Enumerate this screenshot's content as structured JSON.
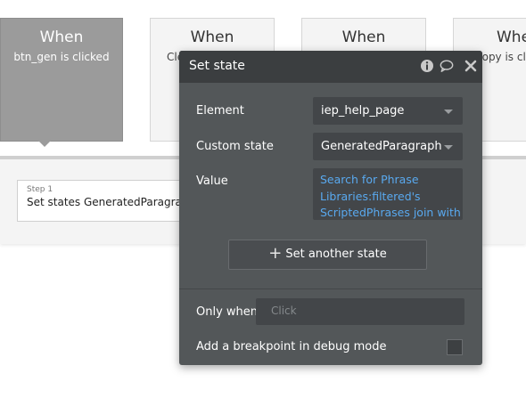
{
  "events": [
    {
      "when": "When",
      "sub": "btn_gen is clicked",
      "active": true
    },
    {
      "when": "When",
      "sub": "Cle"
    },
    {
      "when": "When",
      "sub": ""
    },
    {
      "when": "Whe",
      "sub": "copy is cl"
    }
  ],
  "step": {
    "number": "Step 1",
    "text": "Set states GeneratedParagraph"
  },
  "modal": {
    "title": "Set state",
    "icons": [
      "info-icon",
      "comment-icon",
      "close-icon"
    ],
    "element_label": "Element",
    "element_value": "iep_help_page",
    "custom_state_label": "Custom state",
    "custom_state_value": "GeneratedParagraph",
    "value_label": "Value",
    "value_lines": [
      "Search for Phrase",
      "Libraries:filtered's",
      "ScriptedPhrases join with"
    ],
    "set_another_label": "Set another state",
    "only_when_label": "Only when",
    "only_when_placeholder": "Click",
    "breakpoint_label": "Add a breakpoint in debug mode",
    "breakpoint_checked": false
  },
  "colors": {
    "modal_bg": "#535759",
    "modal_header": "#3b3e40",
    "value_text": "#59a9ef",
    "active_card": "#9b9b9b"
  }
}
